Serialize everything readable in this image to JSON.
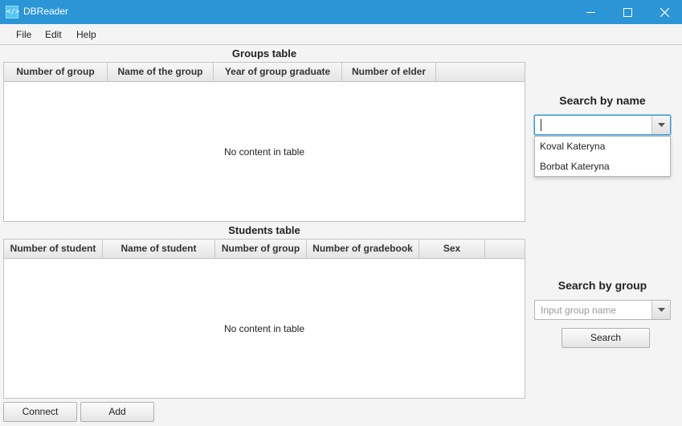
{
  "window": {
    "title": "DBReader",
    "icon_text": "</>",
    "controls": [
      "minimize-icon",
      "maximize-icon",
      "close-icon"
    ]
  },
  "menu": {
    "file": "File",
    "edit": "Edit",
    "help": "Help"
  },
  "groups_table": {
    "title": "Groups table",
    "columns": [
      "Number of group",
      "Name of the group",
      "Year of group graduate",
      "Number of elder"
    ],
    "rows": [],
    "empty_message": "No content in table"
  },
  "students_table": {
    "title": "Students table",
    "columns": [
      "Number of student",
      "Name of student",
      "Number of group",
      "Number of gradebook",
      "Sex"
    ],
    "rows": [],
    "empty_message": "No content in table"
  },
  "search_by_name": {
    "heading": "Search by name",
    "value": "",
    "options": [
      "Koval Kateryna",
      "Borbat Kateryna"
    ]
  },
  "search_by_group": {
    "heading": "Search by group",
    "placeholder": "Input group name",
    "value": "",
    "button": "Search"
  },
  "actions": {
    "connect": "Connect",
    "add": "Add"
  },
  "colors": {
    "titlebar": "#2b95d6",
    "focus_border": "#3d9ad8"
  }
}
